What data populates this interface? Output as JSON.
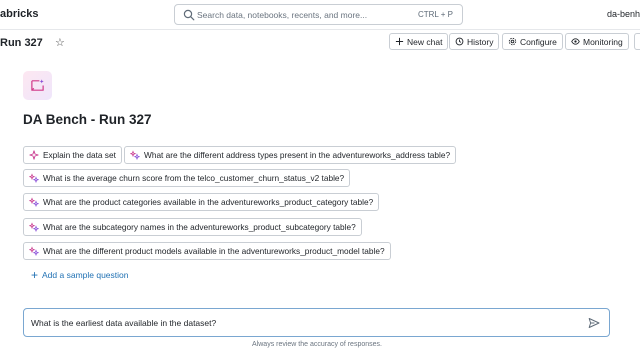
{
  "header": {
    "brand": "abricks",
    "search_placeholder": "Search data, notebooks, recents, and more...",
    "search_shortcut": "CTRL + P",
    "user": "da-benh"
  },
  "toolbar": {
    "title": "Run 327",
    "new_chat": "New chat",
    "history": "History",
    "configure": "Configure",
    "monitoring": "Monitoring"
  },
  "space": {
    "title": "DA Bench - Run 327"
  },
  "sample_questions": [
    "Explain the data set",
    "What are the different address types present in the adventureworks_address table?",
    "What is the average churn score from the telco_customer_churn_status_v2 table?",
    "What are the product categories available in the adventureworks_product_category table?",
    "What are the subcategory names in the adventureworks_product_subcategory table?",
    "What are the different product models available in the adventureworks_product_model table?"
  ],
  "add_sample_label": "Add a sample question",
  "chat": {
    "value": "What is the earliest data available in the dataset?"
  },
  "disclaimer": "Always review the accuracy of responses.",
  "colors": {
    "accent": "#2272b4",
    "border": "#c9ced4",
    "icon_pink": "#e0398a",
    "icon_purple": "#8a4fd8"
  },
  "icons": [
    "search-icon",
    "star-icon",
    "plus-icon",
    "history-icon",
    "gear-icon",
    "eye-icon",
    "sparkle-icon",
    "send-icon"
  ]
}
